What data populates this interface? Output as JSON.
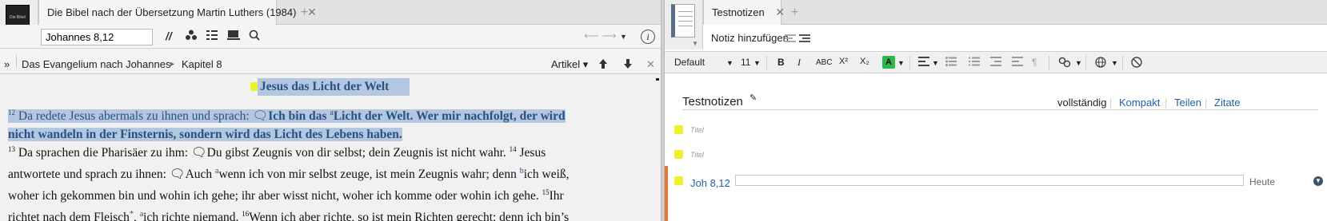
{
  "left_pane": {
    "tab_title": "Die Bibel nach der Übersetzung Martin Luthers (1984)",
    "tab_close": "✕",
    "tab_add": "+",
    "book_cover_text": "Die Bibel",
    "reference_input": "Johannes 8,12",
    "breadcrumb": {
      "chevron": "»",
      "book": "Das Evangelium nach Johannes",
      "separator": "▸",
      "chapter": "Kapitel 8"
    },
    "artikel_label": "Artikel ▾",
    "heading": "Jesus das Licht der Welt",
    "verse12": {
      "num": "12",
      "line1_intro": "Da redete Jesus abermals zu ihnen und sprach: ",
      "line1_bold_a": "Ich bin das ",
      "line1_bold_b": "Licht der Welt. Wer mir nachfolgt, der wird",
      "line2_bold": "nicht wandeln in der Finsternis, sondern wird das Licht des Lebens haben."
    },
    "rest_text": {
      "v13": "13",
      "v13_a": " Da sprachen die Pharisäer zu ihm: ",
      "v13_b": "Du gibst Zeugnis von dir selbst; dein Zeugnis ist nicht wahr. ",
      "v14": "14",
      "v14_a": " Jesus",
      "line2_a": "antwortete und sprach zu ihnen: ",
      "line2_b": "Auch ",
      "line2_c": "wenn ich von mir selbst zeuge, ist mein Zeugnis wahr; denn ",
      "line2_d": "ich weiß,",
      "line3": "woher ich gekommen bin und wohin ich gehe; ihr aber wisst nicht, woher ich komme oder wohin ich gehe. ",
      "v15": "15",
      "v15_a": "Ihr",
      "line4_a": "richtet nach dem Fleisch",
      "line4_star": "*",
      "line4_b": ", ",
      "line4_c": "ich richte niemand. ",
      "v16": "16",
      "line4_d": "Wenn ich aber richte, so ist mein Richten gerecht; denn ich bin’s",
      "sup_a": "a",
      "sup_b": "b"
    }
  },
  "right_pane": {
    "tab_title": "Testnotizen",
    "tab_close": "✕",
    "tab_add": "+",
    "add_note": "Notiz hinzufügen",
    "font_name": "Default",
    "font_size": "11",
    "format_buttons": {
      "bold": "B",
      "italic": "I",
      "smallcaps": "ABC",
      "superscript": "X²",
      "subscript": "X₂",
      "color": "A"
    },
    "note_title": "Testnotizen",
    "view_options": {
      "full": "vollständig",
      "compact": "Kompakt",
      "share": "Teilen",
      "cite": "Zitate"
    },
    "placeholder_1": "Titel",
    "placeholder_2": "Titel",
    "note_ref": "Joh 8,12",
    "note_date": "Heute"
  },
  "colors": {
    "selection": "#b3c8e0",
    "highlight": "#eef028",
    "link": "#1e60a8",
    "accent_orange": "#e8783a"
  }
}
